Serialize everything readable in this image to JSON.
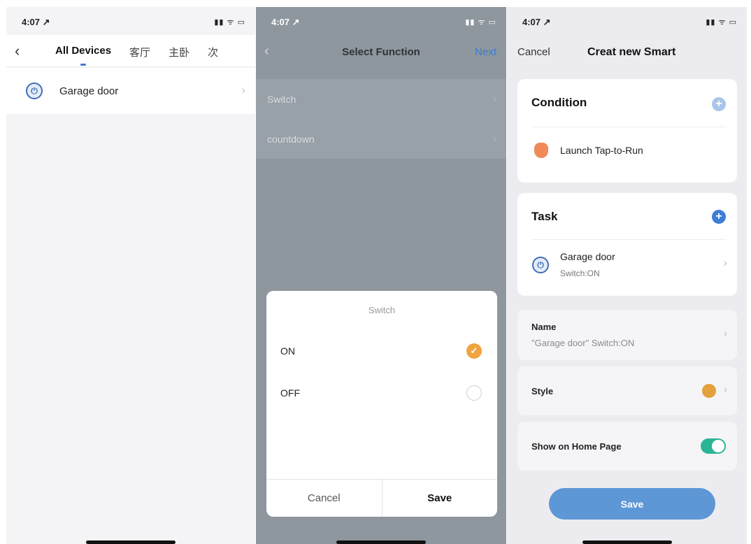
{
  "status": {
    "time": "4:07 ↗",
    "icons": "▮▮ ᯤ ▭"
  },
  "screen1": {
    "back_icon": "‹",
    "tabs": [
      "All Devices",
      "客厅",
      "主卧",
      "次"
    ],
    "device": {
      "name": "Garage door",
      "icon": "power-icon"
    }
  },
  "screen2": {
    "back_icon": "‹",
    "title": "Select Function",
    "next_label": "Next",
    "functions": [
      "Switch",
      "countdown"
    ],
    "dialog": {
      "title": "Switch",
      "options": [
        {
          "label": "ON",
          "selected": true
        },
        {
          "label": "OFF",
          "selected": false
        }
      ],
      "cancel_label": "Cancel",
      "save_label": "Save"
    }
  },
  "screen3": {
    "cancel_label": "Cancel",
    "title": "Creat new Smart",
    "condition": {
      "heading": "Condition",
      "item": "Launch Tap-to-Run"
    },
    "task": {
      "heading": "Task",
      "device": "Garage door",
      "action": "Switch:ON"
    },
    "name": {
      "label": "Name",
      "value": "\"Garage door\" Switch:ON"
    },
    "style_label": "Style",
    "show_home_label": "Show on Home Page",
    "show_home_on": true,
    "save_label": "Save"
  },
  "colors": {
    "accent": "#3a7bd5",
    "check": "#f0a33f",
    "toggle": "#2bb596",
    "save_button": "#5d97d6"
  }
}
